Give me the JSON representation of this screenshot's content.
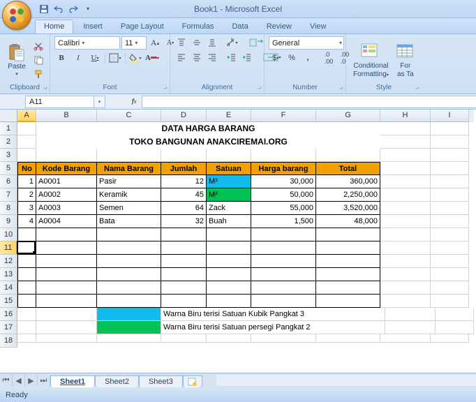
{
  "window": {
    "title": "Book1 - Microsoft Excel"
  },
  "tabs": {
    "home": "Home",
    "insert": "Insert",
    "pagelayout": "Page Layout",
    "formulas": "Formulas",
    "data": "Data",
    "review": "Review",
    "view": "View"
  },
  "ribbon": {
    "clipboard": {
      "paste": "Paste",
      "label": "Clipboard"
    },
    "font": {
      "name": "Calibri",
      "size": "11",
      "label": "Font"
    },
    "alignment": {
      "label": "Alignment"
    },
    "number": {
      "format": "General",
      "label": "Number"
    },
    "styles": {
      "conditional": "Conditional",
      "formatting": "Formatting",
      "format": "For",
      "asTable": "as Ta",
      "label": "Style"
    }
  },
  "namebox": {
    "value": "A11"
  },
  "columns": [
    "A",
    "B",
    "C",
    "D",
    "E",
    "F",
    "G",
    "H",
    "I"
  ],
  "rows": [
    "1",
    "2",
    "3",
    "5",
    "6",
    "7",
    "8",
    "9",
    "10",
    "11",
    "12",
    "13",
    "14",
    "15",
    "16",
    "17",
    "18"
  ],
  "titles": {
    "line1": "DATA HARGA BARANG",
    "line2": "TOKO BANGUNAN ANAKCIREMAI.ORG"
  },
  "headers": {
    "no": "No",
    "kode": "Kode Barang",
    "nama": "Nama Barang",
    "jumlah": "Jumlah",
    "satuan": "Satuan",
    "harga": "Harga barang",
    "total": "Total"
  },
  "data_rows": [
    {
      "no": "1",
      "kode": "A0001",
      "nama": "Pasir",
      "jumlah": "12",
      "satuan": "M³",
      "harga": "30,000",
      "total": "360,000"
    },
    {
      "no": "2",
      "kode": "A0002",
      "nama": "Keramik",
      "jumlah": "45",
      "satuan": "M²",
      "harga": "50,000",
      "total": "2,250,000"
    },
    {
      "no": "3",
      "kode": "A0003",
      "nama": "Semen",
      "jumlah": "64",
      "satuan": "Zack",
      "harga": "55,000",
      "total": "3,520,000"
    },
    {
      "no": "4",
      "kode": "A0004",
      "nama": "Bata",
      "jumlah": "32",
      "satuan": "Buah",
      "harga": "1,500",
      "total": "48,000"
    }
  ],
  "legend": {
    "blue": "Warna Biru terisi Satuan Kubik Pangkat 3",
    "green": "Warna Biru terisi Satuan persegi Pangkat 2"
  },
  "sheet_tabs": {
    "s1": "Sheet1",
    "s2": "Sheet2",
    "s3": "Sheet3"
  },
  "status": {
    "ready": "Ready"
  },
  "chart_data": {
    "type": "table",
    "title": "DATA HARGA BARANG — TOKO BANGUNAN ANAKCIREMAI.ORG",
    "columns": [
      "No",
      "Kode Barang",
      "Nama Barang",
      "Jumlah",
      "Satuan",
      "Harga barang",
      "Total"
    ],
    "rows": [
      [
        1,
        "A0001",
        "Pasir",
        12,
        "M3",
        30000,
        360000
      ],
      [
        2,
        "A0002",
        "Keramik",
        45,
        "M2",
        50000,
        2250000
      ],
      [
        3,
        "A0003",
        "Semen",
        64,
        "Zack",
        55000,
        3520000
      ],
      [
        4,
        "A0004",
        "Bata",
        32,
        "Buah",
        1500,
        48000
      ]
    ]
  }
}
